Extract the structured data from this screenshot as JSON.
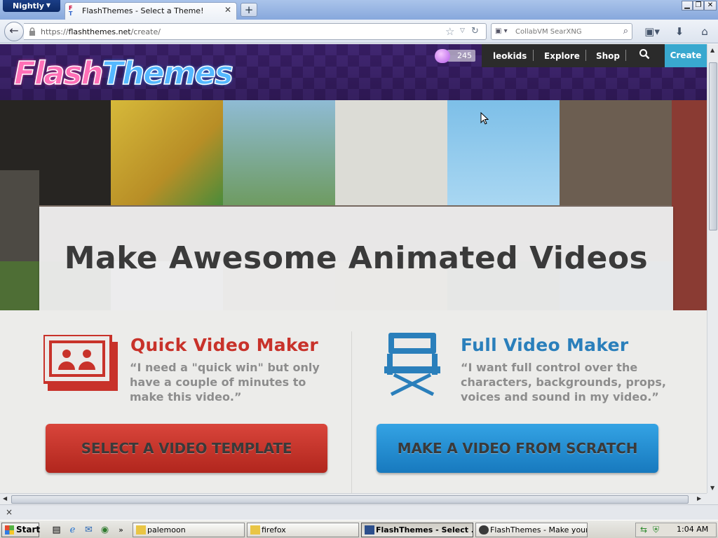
{
  "browser": {
    "app_menu": "Nightly",
    "tab_title": "FlashThemes - Select a Theme!",
    "new_tab": "+",
    "url_scheme": "https://",
    "url_host": "flashthemes.net",
    "url_path": "/create/",
    "search_placeholder": "CollabVM SearXNG",
    "status_close": "×"
  },
  "site": {
    "logo_part1": "Flash",
    "logo_part2": "Themes",
    "coins": "245",
    "nav": [
      "leokids",
      "Explore",
      "Shop"
    ],
    "create": "Create",
    "hero_title": "Make Awesome Animated Videos"
  },
  "quick": {
    "title": "Quick Video Maker",
    "quote_lines": [
      "“I need a \"quick win\" but only",
      "have a couple of minutes to",
      "make this video.”"
    ],
    "button": "SELECT A VIDEO TEMPLATE",
    "color": "#c8322a"
  },
  "full": {
    "title": "Full Video Maker",
    "quote_lines": [
      "“I want full control over the",
      "characters, backgrounds, props,",
      "voices and sound in my video.”"
    ],
    "button": "MAKE A VIDEO FROM SCRATCH",
    "color": "#2a7fbb"
  },
  "taskbar": {
    "start": "Start",
    "items": [
      "palemoon",
      "firefox",
      "FlashThemes - Select ...",
      "FlashThemes - Make your..."
    ],
    "clock": "1:04 AM"
  }
}
